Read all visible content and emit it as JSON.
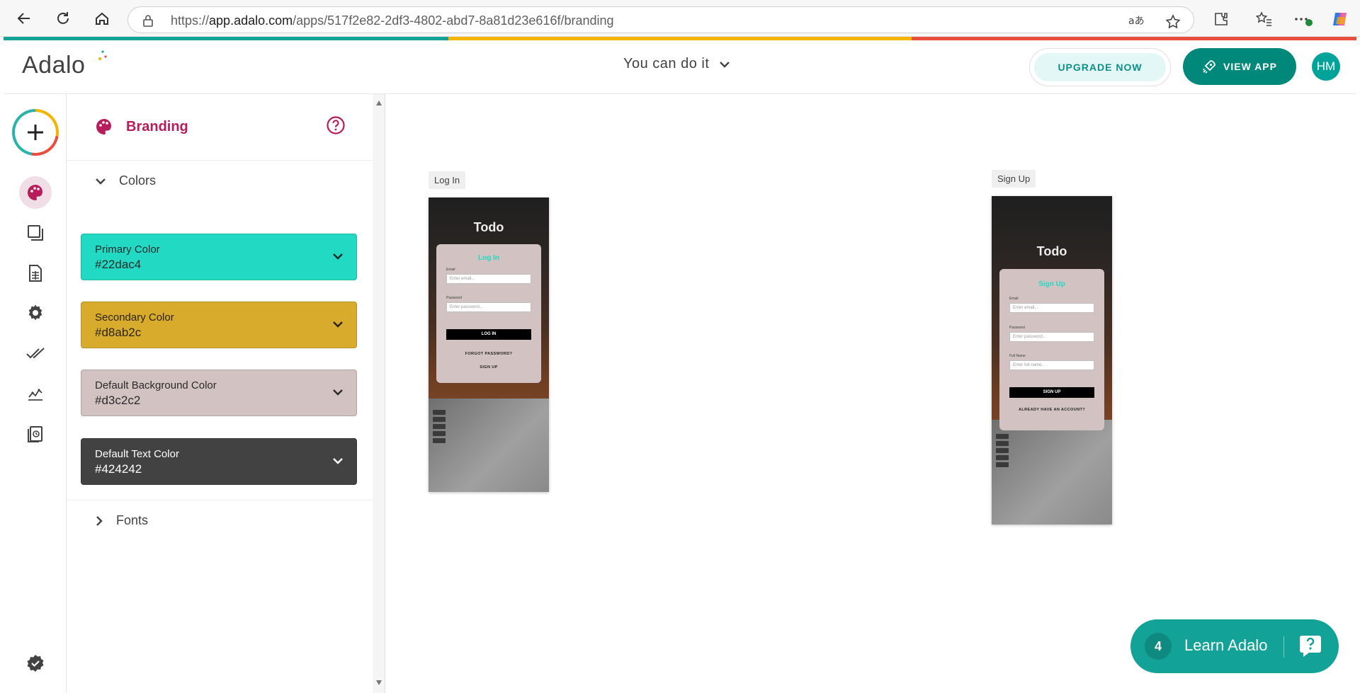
{
  "browser": {
    "url_prefix": "https://",
    "url_host": "app.adalo.com",
    "url_path": "/apps/517f2e82-2df3-4802-abd7-8a81d23e616f/branding"
  },
  "header": {
    "logo": "Adalo",
    "app_name": "You can do it",
    "upgrade_label": "UPGRADE NOW",
    "view_app_label": "VIEW APP",
    "avatar_initials": "HM"
  },
  "panel": {
    "title": "Branding",
    "colors_section": "Colors",
    "fonts_section": "Fonts",
    "colors": [
      {
        "label": "Primary Color",
        "value": "#22dac4",
        "bg": "#22dac4",
        "text": "#1f2a2a"
      },
      {
        "label": "Secondary Color",
        "value": "#d8ab2c",
        "bg": "#d8ab2c",
        "text": "#2a2410"
      },
      {
        "label": "Default Background Color",
        "value": "#d3c2c2",
        "bg": "#d3c2c2",
        "text": "#2a2a2a"
      },
      {
        "label": "Default Text Color",
        "value": "#424242",
        "bg": "#424242",
        "text": "#ffffff"
      }
    ]
  },
  "canvas": {
    "screens": [
      {
        "label": "Log In",
        "app_title": "Todo",
        "card_title": "Log In",
        "email_label": "Email",
        "email_placeholder": "Enter email...",
        "password_label": "Password",
        "password_placeholder": "Enter password...",
        "button": "LOG IN",
        "forgot": "FORGOT PASSWORD?",
        "alt_link": "SIGN UP"
      },
      {
        "label": "Sign Up",
        "app_title": "Todo",
        "card_title": "Sign Up",
        "email_label": "Email",
        "email_placeholder": "Enter email...",
        "password_label": "Password",
        "password_placeholder": "Enter password...",
        "name_label": "Full Name",
        "name_placeholder": "Enter full name...",
        "button": "SIGN UP",
        "alt_link": "ALREADY HAVE AN ACCOUNT?"
      }
    ]
  },
  "learn": {
    "count": "4",
    "label": "Learn Adalo"
  },
  "colors": {
    "brand_pink": "#b81d5b",
    "teal": "#00897b",
    "strip": [
      "#13a297",
      "#f4b400",
      "#e94e3c"
    ]
  }
}
